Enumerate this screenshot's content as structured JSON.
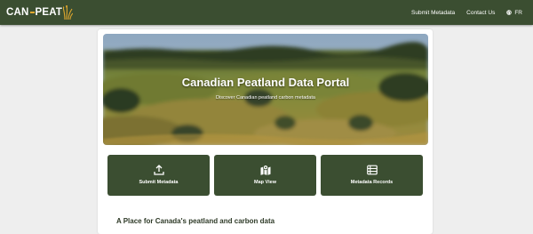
{
  "brand": {
    "logo_text_left": "CAN",
    "logo_text_right": "PEAT",
    "accent_color": "#e0a82e",
    "primary_color": "#3b4e31"
  },
  "nav": {
    "submit_metadata": "Submit Metadata",
    "contact_us": "Contact Us",
    "language": "FR"
  },
  "hero": {
    "title": "Canadian Peatland Data Portal",
    "subtitle": "Discover Canadian peatland carbon metadata"
  },
  "cards": [
    {
      "label": "Submit Metadata",
      "icon": "upload-icon"
    },
    {
      "label": "Map View",
      "icon": "map-icon"
    },
    {
      "label": "Metadata Records",
      "icon": "records-list-icon"
    }
  ],
  "section": {
    "title": "A Place for Canada's peatland and carbon data"
  }
}
